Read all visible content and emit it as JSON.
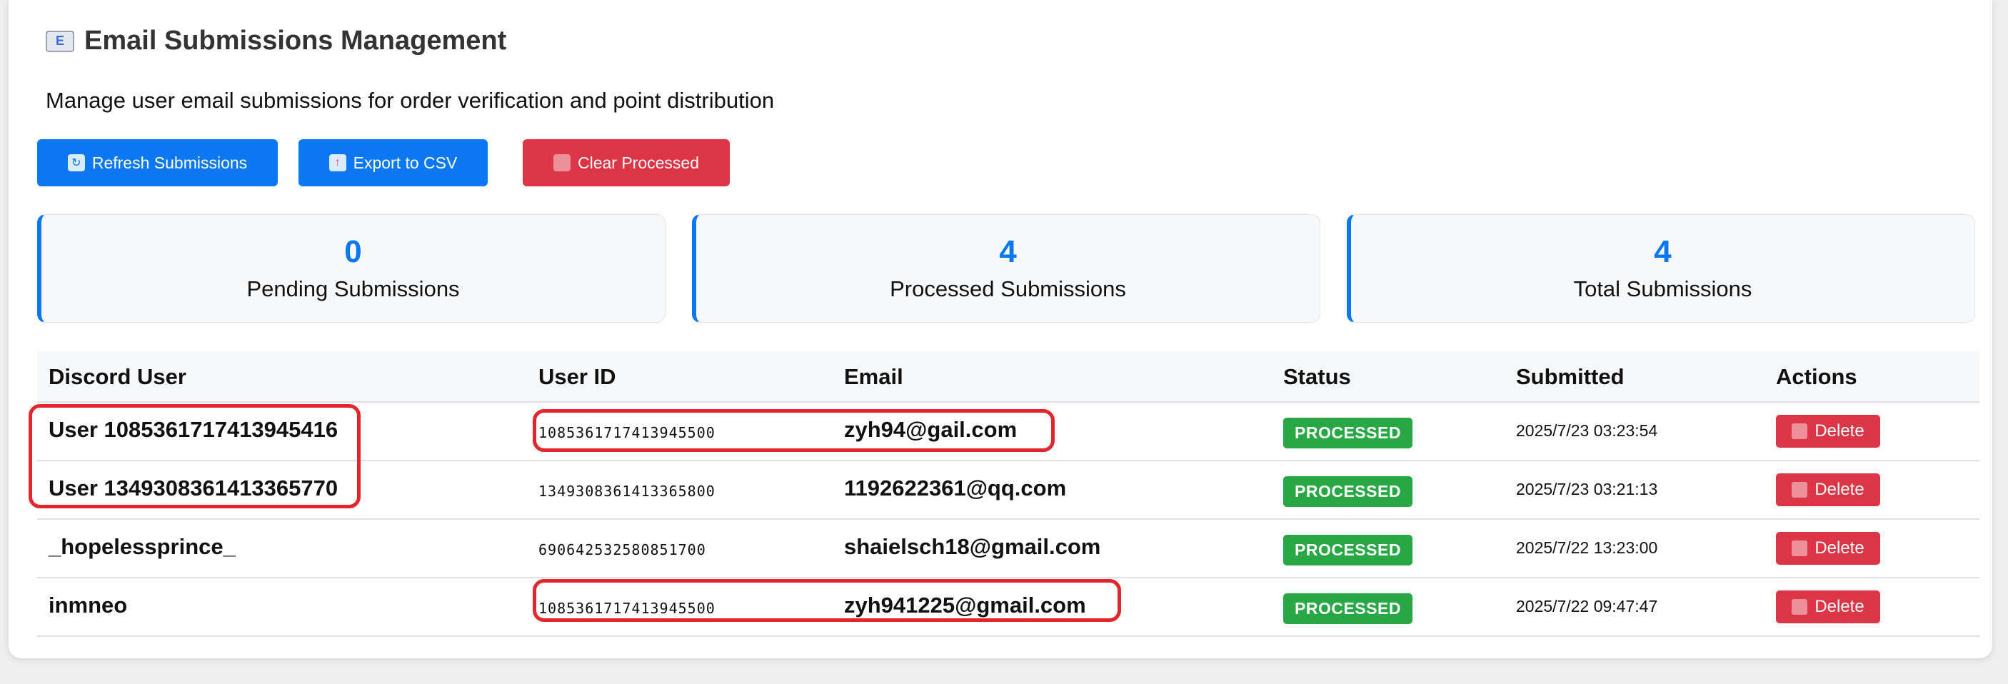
{
  "header": {
    "title_icon": "envelope-icon",
    "title": "Email Submissions Management",
    "subtitle": "Manage user email submissions for order verification and point distribution"
  },
  "toolbar": {
    "refresh_label": "Refresh Submissions",
    "export_label": "Export to CSV",
    "clear_label": "Clear Processed"
  },
  "stats": [
    {
      "value": "0",
      "label": "Pending Submissions"
    },
    {
      "value": "4",
      "label": "Processed Submissions"
    },
    {
      "value": "4",
      "label": "Total Submissions"
    }
  ],
  "table": {
    "headers": [
      "Discord User",
      "User ID",
      "Email",
      "Status",
      "Submitted",
      "Actions"
    ],
    "rows": [
      {
        "user": "User 1085361717413945416",
        "user_id": "1085361717413945500",
        "email": "zyh94@gail.com",
        "status": "PROCESSED",
        "submitted": "2025/7/23 03:23:54",
        "action": "Delete"
      },
      {
        "user": "User 1349308361413365770",
        "user_id": "1349308361413365800",
        "email": "1192622361@qq.com",
        "status": "PROCESSED",
        "submitted": "2025/7/23 03:21:13",
        "action": "Delete"
      },
      {
        "user": "_hopelessprince_",
        "user_id": "690642532580851700",
        "email": "shaielsch18@gmail.com",
        "status": "PROCESSED",
        "submitted": "2025/7/22 13:23:00",
        "action": "Delete"
      },
      {
        "user": "inmneo",
        "user_id": "1085361717413945500",
        "email": "zyh941225@gmail.com",
        "status": "PROCESSED",
        "submitted": "2025/7/22 09:47:47",
        "action": "Delete"
      }
    ]
  },
  "colors": {
    "primary": "#0b78f2",
    "danger": "#dc3545",
    "success": "#28a745",
    "highlight": "#e3262e"
  }
}
